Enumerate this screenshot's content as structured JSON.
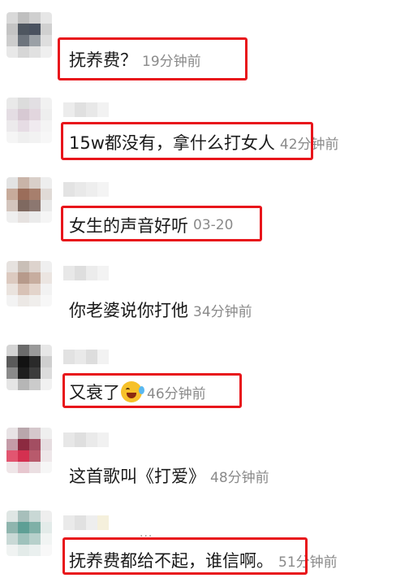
{
  "comments": [
    {
      "text": "抚养费？",
      "time": "19分钟前"
    },
    {
      "text": "15w都没有，拿什么打女人",
      "time": "42分钟前"
    },
    {
      "text": "女生的声音好听",
      "time": "03-20"
    },
    {
      "text": "你老婆说你打他",
      "time": "34分钟前"
    },
    {
      "text": "又衰了",
      "time": "46分钟前"
    },
    {
      "text": "这首歌叫《打爱》",
      "time": "48分钟前"
    },
    {
      "text": "抚养费都给不起，谁信啊。",
      "time": "51分钟前"
    }
  ],
  "more_indicator": "···",
  "colors": {
    "highlight": "#e8151b",
    "time": "#8a8a8a",
    "text": "#1a1a1a"
  },
  "icons": {
    "laughing_crying": "laughing-crying-emoji-icon"
  }
}
